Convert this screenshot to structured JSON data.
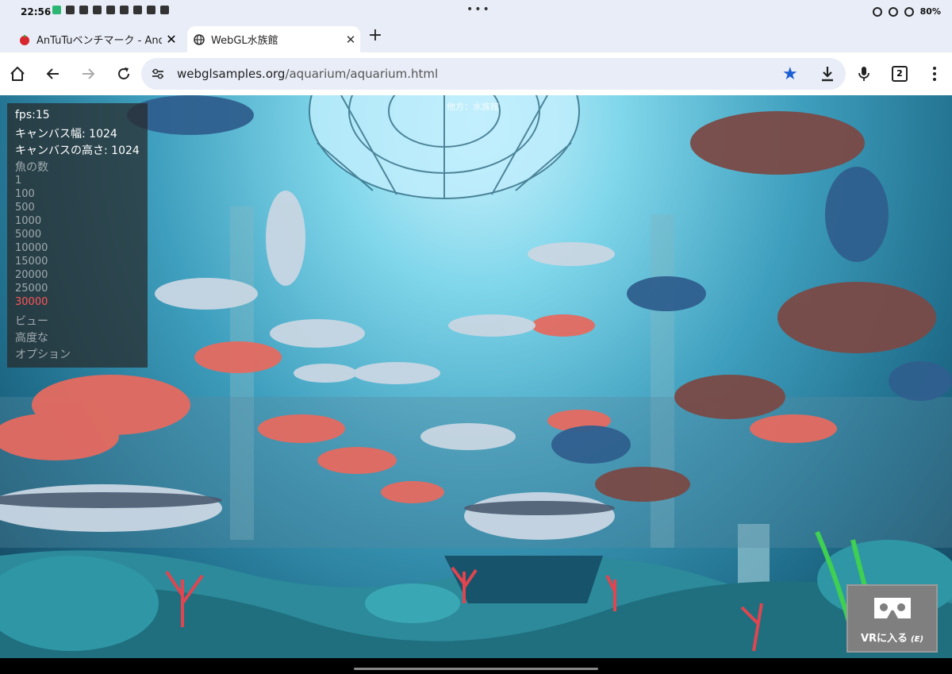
{
  "status_bar": {
    "time": "22:56",
    "battery": "80%"
  },
  "tabs": [
    {
      "title": "AnTuTuベンチマーク - Andr",
      "close": "✕",
      "active": false
    },
    {
      "title": "WebGL水族館",
      "close": "✕",
      "active": true
    }
  ],
  "new_tab": "+",
  "toolbar": {
    "url_host": "webglsamples.org",
    "url_path": "/aquarium/aquarium.html",
    "tab_count": "2"
  },
  "aquarium": {
    "top_label": "他方：水族館",
    "fps": "fps:15",
    "canvas_width": "キャンバス幅: 1024",
    "canvas_height": "キャンバスの高さ: 1024",
    "fish_count_label": "魚の数",
    "fish_options": [
      "1",
      "100",
      "500",
      "1000",
      "5000",
      "10000",
      "15000",
      "20000",
      "25000",
      "30000"
    ],
    "selected_option": "30000",
    "view_label": "ビュー",
    "advanced_label": "高度な",
    "options_label": "オプション",
    "vr_button_label": "VRに入る",
    "vr_button_key": "(E)"
  },
  "colors": {
    "chrome_bg": "#e9edf7",
    "accent_star": "#1a5fd3",
    "selected_option": "#ff5555"
  },
  "icons": [
    "home-icon",
    "back-icon",
    "forward-icon",
    "reload-icon",
    "site-settings-icon",
    "bookmark-star-icon",
    "download-icon",
    "mic-icon",
    "tab-switcher-icon",
    "overflow-menu-icon",
    "vr-headset-icon"
  ]
}
